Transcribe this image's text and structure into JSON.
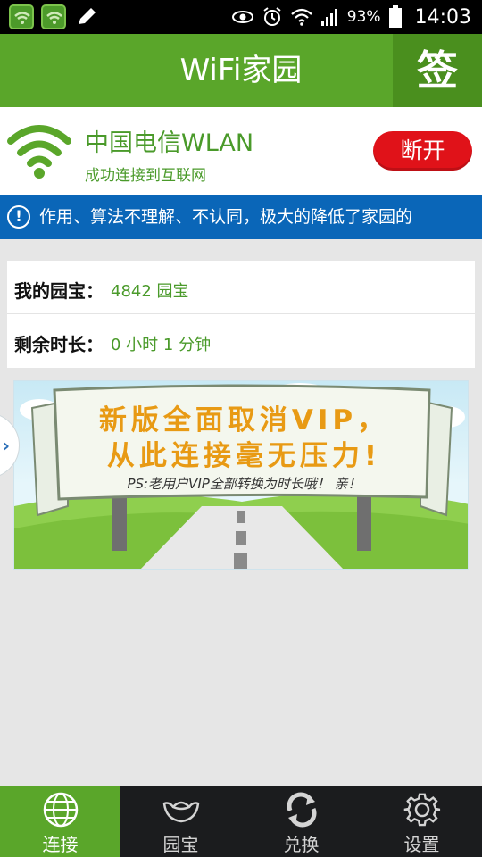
{
  "status_bar": {
    "battery_percent": "93%",
    "time": "14:03"
  },
  "header": {
    "title": "WiFi家园",
    "sign_button": "签"
  },
  "connection": {
    "network_name": "中国电信WLAN",
    "status_text": "成功连接到互联网",
    "disconnect_label": "断开"
  },
  "notice": {
    "text": "作用、算法不理解、不认同，极大的降低了家园的"
  },
  "account": {
    "treasure_label": "我的园宝：",
    "treasure_value": "4842 园宝",
    "remaining_label": "剩余时长：",
    "remaining_value": "0  小时  1  分钟"
  },
  "banner": {
    "line1": "新版全面取消VIP，",
    "line2": "从此连接毫无压力!",
    "ps": "PS:老用户VIP全部转换为时长哦！ 亲！"
  },
  "bottom_nav": {
    "items": [
      {
        "label": "连接",
        "icon": "globe-icon",
        "active": true
      },
      {
        "label": "园宝",
        "icon": "ingot-icon",
        "active": false
      },
      {
        "label": "兑换",
        "icon": "exchange-icon",
        "active": false
      },
      {
        "label": "设置",
        "icon": "gear-icon",
        "active": false
      }
    ]
  },
  "colors": {
    "brand_green": "#5aa62a",
    "disconnect_red": "#e01219",
    "notice_blue": "#0a66b8"
  }
}
